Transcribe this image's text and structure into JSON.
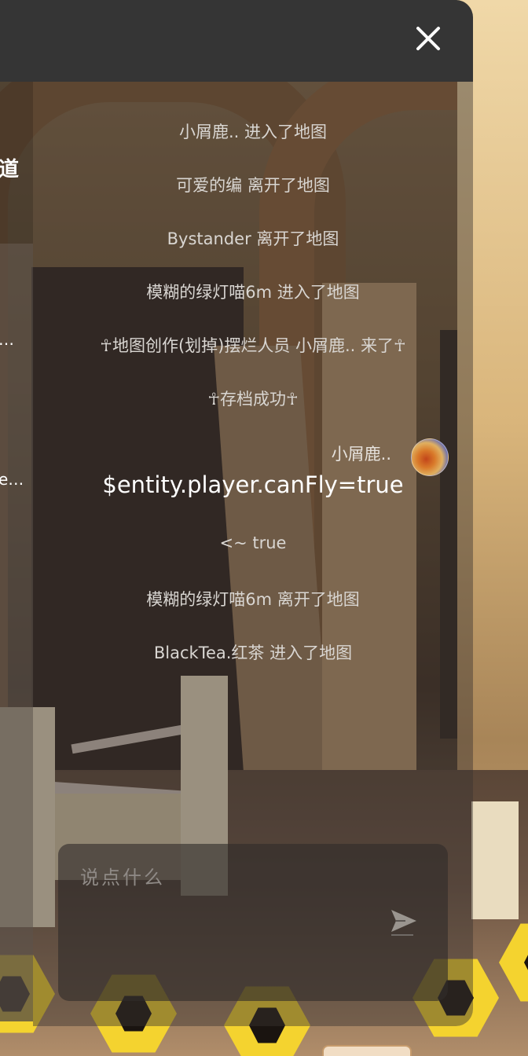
{
  "side_panel": {
    "road_char": "道",
    "more_1": "…",
    "more_2": "e…"
  },
  "chat": {
    "messages": [
      "小屑鹿.. 进入了地图",
      "可爱的编 离开了地图",
      "Bystander 离开了地图",
      "模糊的绿灯喵6m 进入了地图",
      "☥地图创作(划掉)摆烂人员 小屑鹿.. 来了☥",
      "☥存档成功☥"
    ],
    "player_message": {
      "name": "小屑鹿..",
      "text": "$entity.player.canFly=true"
    },
    "messages_after": [
      "<~ true",
      "模糊的绿灯喵6m 离开了地图",
      "BlackTea.红茶 进入了地图"
    ],
    "input": {
      "placeholder": "说点什么",
      "value": ""
    }
  },
  "icons": {
    "close": "close-icon",
    "send": "send-icon",
    "avatar": "player-avatar"
  },
  "colors": {
    "header": "#353535",
    "text_system": "#d9d6d2",
    "text_player": "#ffffff",
    "hex_yellow": "#f4d32f"
  }
}
